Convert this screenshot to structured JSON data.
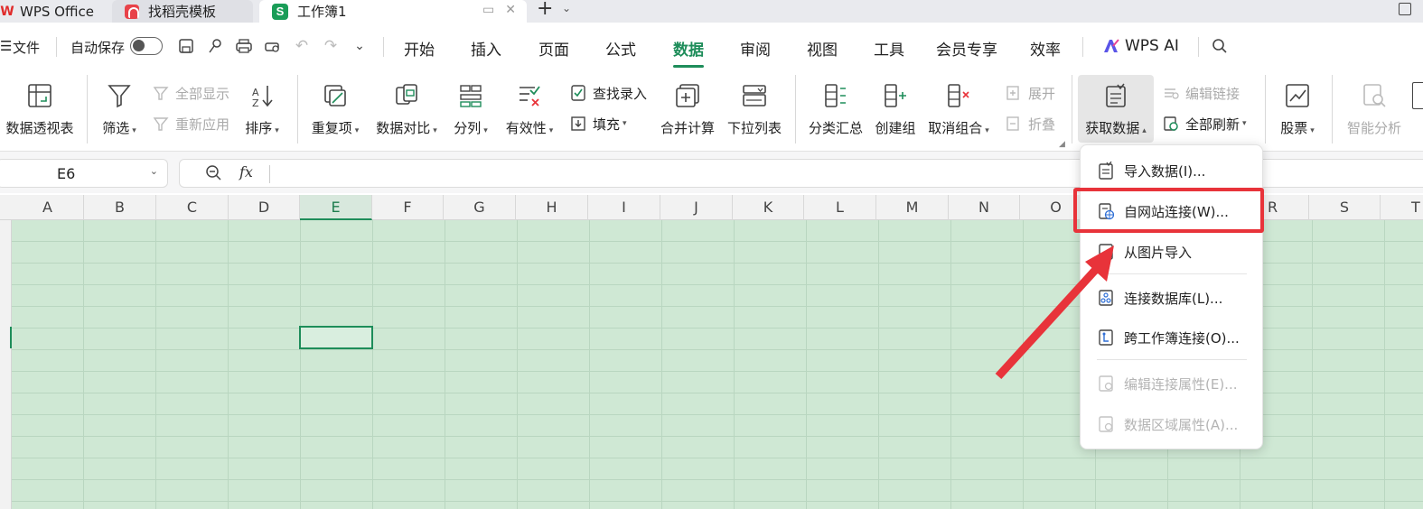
{
  "tabs": [
    {
      "label": "WPS Office"
    },
    {
      "label": "找稻壳模板"
    },
    {
      "label": "工作簿1",
      "logo_letter": "S"
    }
  ],
  "quick": {
    "file_label": "文件",
    "autosave_label": "自动保存"
  },
  "menu": [
    "开始",
    "插入",
    "页面",
    "公式",
    "数据",
    "审阅",
    "视图",
    "工具",
    "会员专享",
    "效率"
  ],
  "menu_active": "数据",
  "wps_ai_label": "WPS AI",
  "ribbon": {
    "pivot": "数据透视表",
    "filter": "筛选",
    "show_all": "全部显示",
    "reapply": "重新应用",
    "sort": "排序",
    "duplicates": "重复项",
    "compare": "数据对比",
    "split": "分列",
    "validity": "有效性",
    "find_entry": "查找录入",
    "fill": "填充",
    "consolidate": "合并计算",
    "dropdown_list": "下拉列表",
    "subtotal": "分类汇总",
    "create_group": "创建组",
    "ungroup": "取消组合",
    "expand": "展开",
    "collapse": "折叠",
    "get_data": "获取数据",
    "edit_links": "编辑链接",
    "refresh_all": "全部刷新",
    "stocks": "股票",
    "smart_analysis": "智能分析"
  },
  "namebox_value": "E6",
  "fx_label": "fx",
  "columns": [
    "A",
    "B",
    "C",
    "D",
    "E",
    "F",
    "G",
    "H",
    "I",
    "J",
    "K",
    "L",
    "M",
    "N",
    "O",
    "R",
    "S",
    "T"
  ],
  "selected_column": "E",
  "selected_cell": "E6",
  "dropdown_menu": [
    {
      "label": "导入数据(I)...",
      "enabled": true
    },
    {
      "label": "自网站连接(W)...",
      "enabled": true,
      "highlighted": true
    },
    {
      "label": "从图片导入",
      "enabled": true
    },
    {
      "label": "连接数据库(L)...",
      "enabled": true
    },
    {
      "label": "跨工作簿连接(O)...",
      "enabled": true
    },
    {
      "label": "编辑连接属性(E)...",
      "enabled": false
    },
    {
      "label": "数据区域属性(A)...",
      "enabled": false
    }
  ],
  "colors": {
    "accent": "#1e8d5a",
    "sheet_fill": "#cfe8d4",
    "highlight": "#e8333a"
  }
}
